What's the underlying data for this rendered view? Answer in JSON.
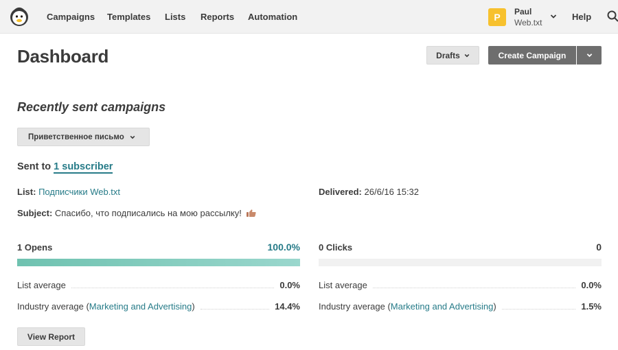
{
  "nav": {
    "items": [
      "Campaigns",
      "Templates",
      "Lists",
      "Reports",
      "Automation"
    ],
    "account": {
      "initial": "P",
      "name": "Paul",
      "org": "Web.txt"
    },
    "help": "Help"
  },
  "header": {
    "title": "Dashboard",
    "drafts_label": "Drafts",
    "create_label": "Create Campaign"
  },
  "recent": {
    "title": "Recently sent campaigns",
    "selected_campaign": "Приветственное письмо",
    "sent_to_prefix": "Sent to",
    "sent_to_link": "1 subscriber",
    "list_label": "List:",
    "list_value": "Подписчики Web.txt",
    "delivered_label": "Delivered:",
    "delivered_value": "26/6/16 15:32",
    "subject_label": "Subject:",
    "subject_value": "Спасибо, что подписались на мою рассылку!"
  },
  "stats": {
    "opens": {
      "label": "1 Opens",
      "rate_text": "100.0%",
      "fill_fraction": 1.0,
      "list_avg_label": "List average",
      "list_avg": "0.0%",
      "industry_label_prefix": "Industry average (",
      "industry_link": "Marketing and Advertising",
      "industry_label_suffix": ")",
      "industry_avg": "14.4%"
    },
    "clicks": {
      "label": "0 Clicks",
      "rate_text": "0",
      "fill_fraction": 0.0,
      "list_avg_label": "List average",
      "list_avg": "0.0%",
      "industry_label_prefix": "Industry average (",
      "industry_link": "Marketing and Advertising",
      "industry_label_suffix": ")",
      "industry_avg": "1.5%"
    }
  },
  "actions": {
    "view_report": "View Report"
  },
  "colors": {
    "accent_link": "#267b88",
    "avatar": "#f7c12e",
    "bar_fill": "#6fc2b0",
    "primary_button": "#6e6e6e"
  }
}
